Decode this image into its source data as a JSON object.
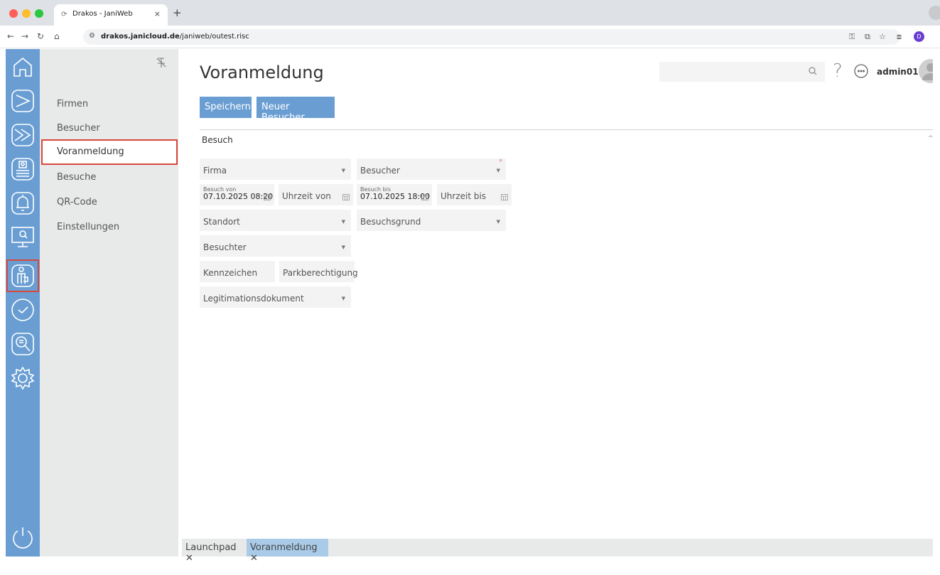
{
  "browser": {
    "tab_title": "Drakos - JaniWeb",
    "tab_close": "×",
    "new_tab": "+",
    "url_host": "drakos.janicloud.de",
    "url_path": "/janiweb/outest.risc",
    "profile_initial": "D"
  },
  "sidebar": {
    "items": [
      {
        "label": "Firmen"
      },
      {
        "label": "Besucher"
      },
      {
        "label": "Voranmeldung"
      },
      {
        "label": "Besuche"
      },
      {
        "label": "QR-Code"
      },
      {
        "label": "Einstellungen"
      }
    ],
    "active_index": 2
  },
  "header": {
    "title": "Voranmeldung",
    "search_placeholder": "",
    "help_glyph": "?",
    "user": "admin01"
  },
  "toolbar": {
    "save_label": "Speichern",
    "new_visitor_label": "Neuer Besucher"
  },
  "section": {
    "title": "Besuch",
    "caret": "^"
  },
  "form": {
    "firma": "Firma",
    "besucher": "Besucher",
    "besucher_required": "*",
    "besuch_von_label": "Besuch von",
    "besuch_von_value": "07.10.2025 08:20",
    "uhrzeit_von": "Uhrzeit von",
    "besuch_bis_label": "Besuch bis",
    "besuch_bis_value": "07.10.2025 18:00",
    "uhrzeit_bis": "Uhrzeit bis",
    "standort": "Standort",
    "besuchsgrund": "Besuchsgrund",
    "besuchter": "Besuchter",
    "kennzeichen": "Kennzeichen",
    "parkberechtigung": "Parkberechtigung",
    "legitimationsdokument": "Legitimationsdokument"
  },
  "bottom_tabs": [
    {
      "label": "Launchpad"
    },
    {
      "label": "Voranmeldung"
    }
  ],
  "colors": {
    "accent": "#6a9ed3",
    "highlight": "#d9473b",
    "active_tab": "#a9cbe8"
  }
}
